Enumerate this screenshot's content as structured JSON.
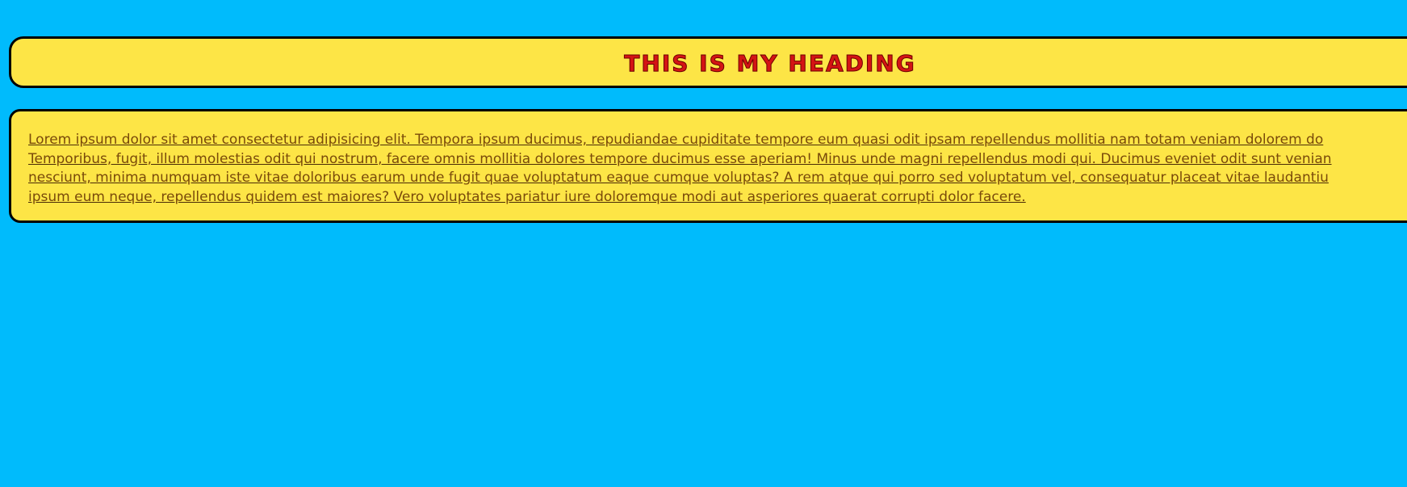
{
  "heading": {
    "text": "This is my heading"
  },
  "paragraph": {
    "lines": [
      "Lorem ipsum dolor sit amet consectetur adipisicing elit. Tempora ipsum ducimus, repudiandae cupiditate tempore eum quasi odit ipsam repellendus mollitia nam totam veniam dolorem do",
      "Temporibus, fugit, illum molestias odit qui nostrum, facere omnis mollitia dolores tempore ducimus esse aperiam! Minus unde magni repellendus modi qui. Ducimus eveniet odit sunt venian",
      "nesciunt, minima numquam iste vitae doloribus earum unde fugit quae voluptatum eaque cumque voluptas? A rem atque qui porro sed voluptatum vel, consequatur placeat vitae laudantiu",
      "ipsum eum neque, repellendus quidem est maiores? Vero voluptates pariatur iure doloremque modi aut asperiores quaerat corrupti dolor facere."
    ]
  },
  "colors": {
    "background": "#00bbfc",
    "panel": "#fde546",
    "panel_border": "#000000",
    "heading_text": "#d41414",
    "body_text": "#7a4a0a"
  }
}
